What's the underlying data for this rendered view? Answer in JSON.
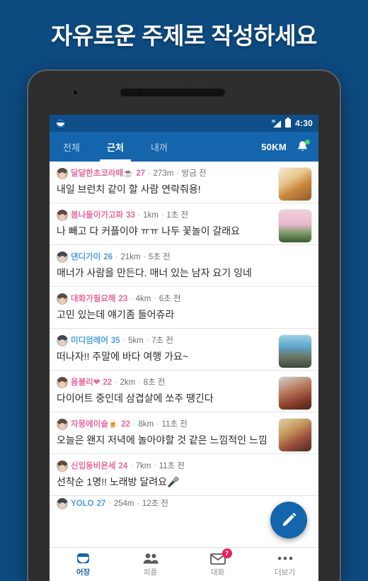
{
  "headline": "자유로운 주제로 작성하세요",
  "status_bar": {
    "app_icon": "app-face-icon",
    "signal_icon": "signal-icon",
    "battery_icon": "battery-icon",
    "time": "4:30"
  },
  "tabs": {
    "items": [
      {
        "label": "전체",
        "active": false
      },
      {
        "label": "근처",
        "active": true
      },
      {
        "label": "내꺼",
        "active": false
      }
    ],
    "distance_label": "50KM",
    "bell_icon": "bell-icon",
    "bell_badge": true
  },
  "colors": {
    "brand_blue": "#1565ad",
    "page_bg": "#0d4a80",
    "female": "#e8699b",
    "male": "#4b9fe0",
    "badge_red": "#ec1e60",
    "badge_green": "#49d463"
  },
  "feed": {
    "rows": [
      {
        "nick": "달달한초코라떼☕",
        "age": "27",
        "distance": "273m",
        "time": "방금 전",
        "gender": "f",
        "message": "내일 브런치 같이 할 사람 연락줘용!",
        "thumb": "t-food"
      },
      {
        "nick": "봄나들이가고파",
        "age": "33",
        "distance": "1km",
        "time": "1초 전",
        "gender": "f",
        "message": "나 빼고 다 커플이야 ㅠㅠ 나두 꽃놀이 갈래요",
        "thumb": "t-blossom"
      },
      {
        "nick": "댄디가이",
        "age": "26",
        "distance": "21km",
        "time": "5초 전",
        "gender": "m",
        "message": "매너가 사람을 만든다. 매너 있는 남자 요기 잉네",
        "thumb": ""
      },
      {
        "nick": "대화가필요해",
        "age": "23",
        "distance": "4km",
        "time": "6초 전",
        "gender": "f",
        "message": "고민 있는데 얘기좀 들어쥬라",
        "thumb": ""
      },
      {
        "nick": "미디엄레어",
        "age": "35",
        "distance": "5km",
        "time": "7초 전",
        "gender": "m",
        "message": "떠나자!! 주말에 바다 여행 가요~",
        "thumb": "t-sea"
      },
      {
        "nick": "욤블리❤",
        "age": "22",
        "distance": "2km",
        "time": "8초 전",
        "gender": "f",
        "message": "다이어트 중인데 삼겹살에 쏘주 땡긴다",
        "thumb": "t-meat"
      },
      {
        "nick": "자몽에이슬🍺",
        "age": "22",
        "distance": "8km",
        "time": "11초 전",
        "gender": "f",
        "message": "오늘은 왠지 저녁에 놀아야할 것 같은 느낌적인 느낌",
        "thumb": "t-room"
      },
      {
        "nick": "신입동비욘세",
        "age": "24",
        "distance": "7km",
        "time": "11초 전",
        "gender": "f",
        "message": "선착순 1명!! 노래방 달려요🎤",
        "thumb": ""
      },
      {
        "nick": "YOLO",
        "age": "27",
        "distance": "254m",
        "time": "12초 전",
        "gender": "m",
        "message": "",
        "thumb": ""
      }
    ],
    "separator": "·"
  },
  "fab": {
    "icon": "pencil-icon"
  },
  "bottom_nav": {
    "items": [
      {
        "label": "어장",
        "icon": "face-icon",
        "active": true,
        "badge": ""
      },
      {
        "label": "피플",
        "icon": "people-icon",
        "active": false,
        "badge": ""
      },
      {
        "label": "대화",
        "icon": "mail-icon",
        "active": false,
        "badge": "7"
      },
      {
        "label": "더보기",
        "icon": "more-icon",
        "active": false,
        "badge": ""
      }
    ]
  }
}
